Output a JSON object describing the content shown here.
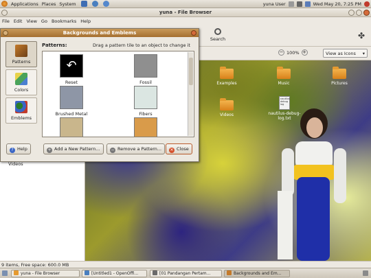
{
  "top_panel": {
    "menus": [
      "Applications",
      "Places",
      "System"
    ],
    "user": "yuna User",
    "clock": "Wed May 20,  7:25 PM"
  },
  "window": {
    "title": "yuna - File Browser",
    "menu": [
      "File",
      "Edit",
      "View",
      "Go",
      "Bookmarks",
      "Help"
    ],
    "search_label": "Search",
    "zoom_value": "100%",
    "view_mode": "View as Icons",
    "sidebar_item": "Videos",
    "status": "9 items, Free space: 600.0 MB"
  },
  "desktop_icons": [
    {
      "label": "Examples"
    },
    {
      "label": "Music"
    },
    {
      "label": "Pictures"
    },
    {
      "label": "Videos"
    },
    {
      "label": "nautilus-debug-log.txt",
      "file_text": "nautilus debug log"
    }
  ],
  "dialog": {
    "title": "Backgrounds and Emblems",
    "categories": [
      "Patterns",
      "Colors",
      "Emblems"
    ],
    "patterns_heading": "Patterns:",
    "hint": "Drag a pattern tile to an object to change it",
    "tiles": [
      {
        "label": "Reset",
        "color": "#000000"
      },
      {
        "label": "Fossil",
        "color": "#8f8f8f"
      },
      {
        "label": "Brushed Metal",
        "color": "#8e96a6"
      },
      {
        "label": "Fibers",
        "color": "#dbe6e2"
      },
      {
        "label": "",
        "color": "#c9b68c"
      },
      {
        "label": "",
        "color": "#d99b4a"
      }
    ],
    "buttons": {
      "help": "Help",
      "add": "Add a New Pattern...",
      "remove": "Remove a Pattern...",
      "close": "Close"
    }
  },
  "taskbar": [
    {
      "label": "yuna - File Browser"
    },
    {
      "label": "[Untitled1 - OpenOffi..."
    },
    {
      "label": "[01 Pandangan Pertam..."
    },
    {
      "label": "Backgrounds and Em..."
    }
  ]
}
